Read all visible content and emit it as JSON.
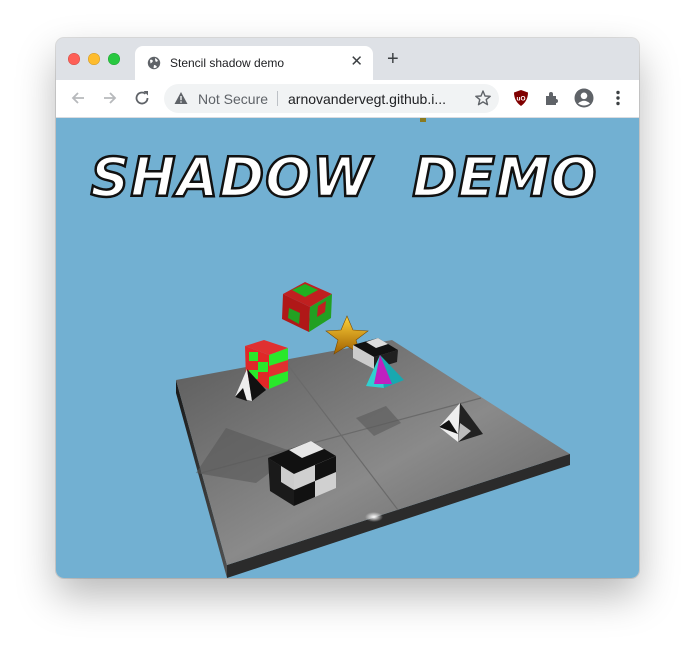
{
  "tab": {
    "title": "Stencil shadow demo",
    "close_label": "✕",
    "new_tab_label": "+"
  },
  "omnibox": {
    "security_label": "Not Secure",
    "url": "arnovandervegt.github.i..."
  },
  "toolbar_icons": [
    "back-arrow-icon",
    "forward-arrow-icon",
    "reload-icon",
    "warning-icon",
    "bookmark-star-icon",
    "ublock-extension-icon",
    "puzzle-extensions-icon",
    "profile-avatar-icon",
    "kebab-menu-icon"
  ],
  "scene": {
    "title": "SHADOW  DEMO",
    "background_color": "#72b0d2",
    "objects": [
      "floor-plate",
      "red-green-cube-floating",
      "red-green-cube",
      "gold-star",
      "checker-cube-large",
      "checker-cube-small",
      "checker-pyramid-left",
      "checker-pyramid-right",
      "magenta-cyan-pyramid"
    ]
  }
}
